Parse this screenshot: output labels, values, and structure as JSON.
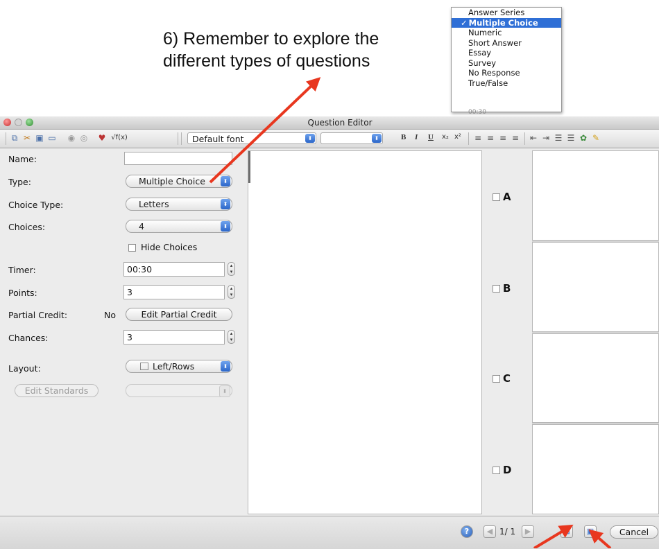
{
  "annotation": {
    "line1": "6) Remember to explore the",
    "line2": "different types of questions"
  },
  "type_dropdown": {
    "options": [
      "Answer Series",
      "Multiple Choice",
      "Numeric",
      "Short Answer",
      "Essay",
      "Survey",
      "No Response",
      "True/False"
    ],
    "selected": "Multiple Choice",
    "check_glyph": "✓",
    "tail_text": "00:30"
  },
  "window": {
    "title": "Question Editor"
  },
  "toolbar": {
    "font": "Default font",
    "size": "",
    "format_buttons": [
      "B",
      "I",
      "U",
      "x₂",
      "x²"
    ]
  },
  "form": {
    "name_label": "Name:",
    "name_value": "",
    "type_label": "Type:",
    "type_value": "Multiple Choice",
    "choice_type_label": "Choice Type:",
    "choice_type_value": "Letters",
    "choices_label": "Choices:",
    "choices_value": "4",
    "hide_choices_label": "Hide Choices",
    "timer_label": "Timer:",
    "timer_value": "00:30",
    "points_label": "Points:",
    "points_value": "3",
    "partial_credit_label": "Partial Credit:",
    "partial_credit_value": "No",
    "edit_partial_credit_label": "Edit Partial Credit",
    "chances_label": "Chances:",
    "chances_value": "3",
    "layout_label": "Layout:",
    "layout_value": "Left/Rows",
    "edit_standards_label": "Edit Standards",
    "standards_value": ""
  },
  "choices": [
    "A",
    "B",
    "C",
    "D"
  ],
  "bottom": {
    "page_indicator": "1/ 1",
    "cancel_label": "Cancel"
  },
  "colors": {
    "accent": "#2f6fd6",
    "arrow": "#e8371f",
    "window_bg": "#ececec"
  }
}
